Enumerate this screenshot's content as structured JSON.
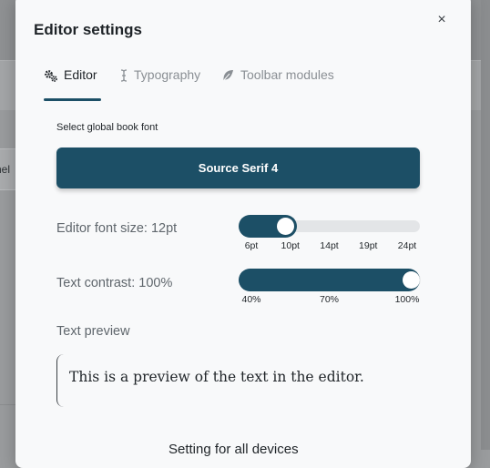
{
  "background": {
    "fragment_text": "nel"
  },
  "dialog": {
    "title": "Editor settings",
    "close_label": "×",
    "tabs": [
      {
        "label": "Editor",
        "icon": "gears-icon",
        "active": true
      },
      {
        "label": "Typography",
        "icon": "text-cursor-icon",
        "active": false
      },
      {
        "label": "Toolbar modules",
        "icon": "feather-icon",
        "active": false
      }
    ],
    "font_select_label": "Select global book font",
    "font_button_label": "Source Serif 4",
    "font_size": {
      "label": "Editor font size: 12pt",
      "value_index": 1,
      "ticks": [
        "6pt",
        "10pt",
        "14pt",
        "19pt",
        "24pt"
      ]
    },
    "contrast": {
      "label": "Text contrast: 100%",
      "value_percent": 100,
      "ticks": [
        "40%",
        "70%",
        "100%"
      ]
    },
    "preview_label": "Text preview",
    "preview_text": "This is a preview of the text in the editor.",
    "next_section_heading": "Setting for all devices"
  },
  "colors": {
    "accent": "#1c4f66",
    "track": "#e3e5e7",
    "overlay": "#9a9c9e"
  }
}
